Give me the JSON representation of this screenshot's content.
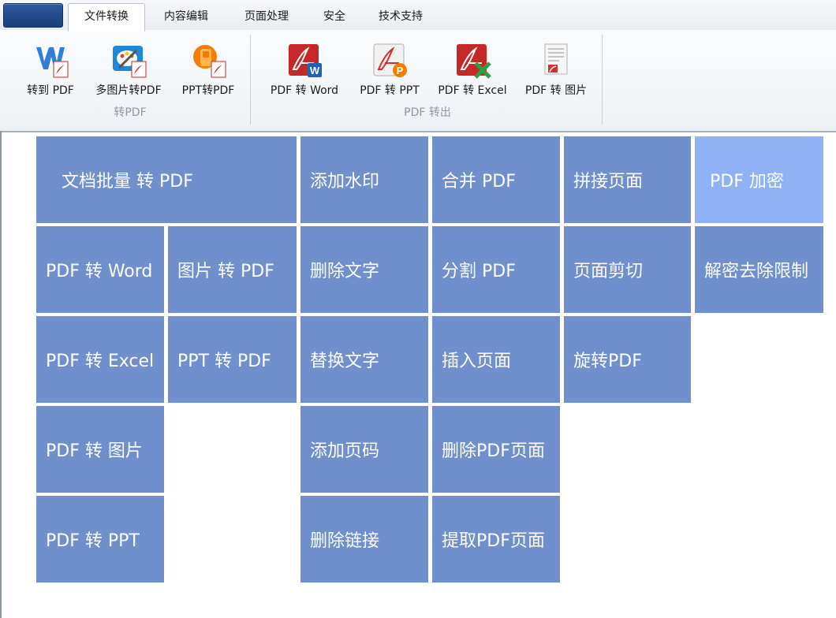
{
  "tabs": [
    {
      "label": "文件转换",
      "active": true
    },
    {
      "label": "内容编辑"
    },
    {
      "label": "页面处理"
    },
    {
      "label": "安全"
    },
    {
      "label": "技术支持"
    }
  ],
  "ribbon": {
    "to_pdf_group": {
      "label": "转PDF",
      "buttons": [
        {
          "label": "转到 PDF",
          "icon": "word-to-pdf-icon"
        },
        {
          "label": "多图片转PDF",
          "icon": "image-to-pdf-icon"
        },
        {
          "label": "PPT转PDF",
          "icon": "ppt-to-pdf-icon"
        }
      ]
    },
    "from_pdf_group": {
      "label": "PDF 转出",
      "buttons": [
        {
          "label": "PDF 转 Word",
          "icon": "pdf-to-word-icon"
        },
        {
          "label": "PDF 转 PPT",
          "icon": "pdf-to-ppt-icon"
        },
        {
          "label": "PDF 转 Excel",
          "icon": "pdf-to-excel-icon"
        },
        {
          "label": "PDF 转 图片",
          "icon": "pdf-to-image-icon"
        }
      ]
    }
  },
  "tiles": {
    "batch_to_pdf": "文档批量 转 PDF",
    "pdf_to_word": "PDF 转 Word",
    "image_to_pdf": "图片 转 PDF",
    "pdf_to_excel": "PDF 转 Excel",
    "ppt_to_pdf": "PPT 转 PDF",
    "pdf_to_image": "PDF 转 图片",
    "pdf_to_ppt": "PDF 转 PPT",
    "add_watermark": "添加水印",
    "delete_text": "删除文字",
    "replace_text": "替换文字",
    "add_page_number": "添加页码",
    "delete_link": "删除链接",
    "merge_pdf": "合并 PDF",
    "split_pdf": "分割 PDF",
    "insert_page": "插入页面",
    "delete_pdf_page": "删除PDF页面",
    "extract_pdf_page": "提取PDF页面",
    "join_pages": "拼接页面",
    "crop_page": "页面剪切",
    "rotate_pdf": "旋转PDF",
    "pdf_encrypt": "PDF 加密",
    "decrypt_remove_limits": "解密去除限制"
  },
  "colors": {
    "tile": "#6f8fcd",
    "tile_highlight": "#8fb2f7",
    "app_button": "#1b3f78"
  }
}
